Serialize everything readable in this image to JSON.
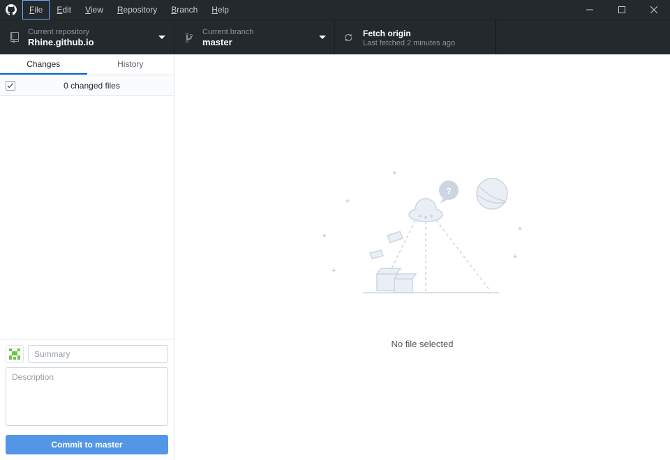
{
  "menu": {
    "file": "File",
    "edit": "Edit",
    "view": "View",
    "repository": "Repository",
    "branch": "Branch",
    "help": "Help"
  },
  "toolbar": {
    "repo": {
      "label": "Current repository",
      "value": "Rhine.github.io"
    },
    "branch": {
      "label": "Current branch",
      "value": "master"
    },
    "fetch": {
      "label": "Fetch origin",
      "value": "Last fetched 2 minutes ago"
    }
  },
  "tabs": {
    "changes": "Changes",
    "history": "History"
  },
  "changes": {
    "header": "0 changed files"
  },
  "commit": {
    "summary_placeholder": "Summary",
    "description_placeholder": "Description",
    "button_prefix": "Commit to ",
    "button_branch": "master"
  },
  "main": {
    "empty_text": "No file selected"
  }
}
